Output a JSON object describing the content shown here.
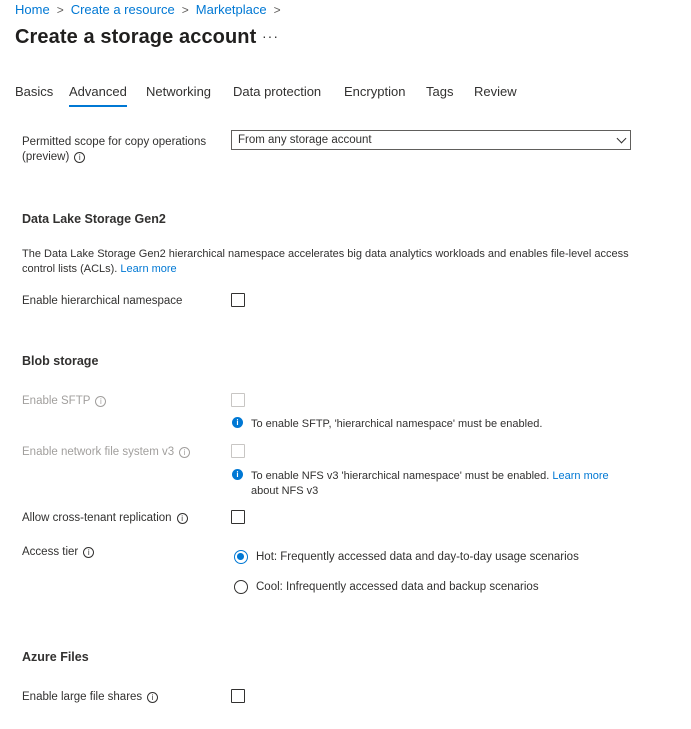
{
  "breadcrumb": {
    "items": [
      "Home",
      "Create a resource",
      "Marketplace"
    ],
    "separator": ">"
  },
  "page": {
    "title": "Create a storage account",
    "more": "···"
  },
  "tabs": [
    {
      "label": "Basics",
      "active": false
    },
    {
      "label": "Advanced",
      "active": true
    },
    {
      "label": "Networking",
      "active": false
    },
    {
      "label": "Data protection",
      "active": false
    },
    {
      "label": "Encryption",
      "active": false
    },
    {
      "label": "Tags",
      "active": false
    },
    {
      "label": "Review",
      "active": false
    }
  ],
  "copy_scope": {
    "label_line1": "Permitted scope for copy operations",
    "label_line2": "(preview)",
    "value": "From any storage account"
  },
  "data_lake": {
    "title": "Data Lake Storage Gen2",
    "desc_line1": "The Data Lake Storage Gen2 hierarchical namespace accelerates big data analytics workloads and enables file-level access",
    "desc_line2": "control lists (ACLs).",
    "learn_more": "Learn more",
    "hns_label": "Enable hierarchical namespace",
    "hns_checked": false
  },
  "blob": {
    "title": "Blob storage",
    "sftp_label": "Enable SFTP",
    "sftp_note": "To enable SFTP, 'hierarchical namespace' must be enabled.",
    "nfs_label": "Enable network file system v3",
    "nfs_note": "To enable NFS v3 'hierarchical namespace' must be enabled.",
    "nfs_learn_more_1": "Learn more",
    "nfs_learn_more_2": "about NFS v3",
    "cross_tenant_label": "Allow cross-tenant replication",
    "cross_tenant_checked": false,
    "access_tier_label": "Access tier",
    "tiers": [
      {
        "label": "Hot: Frequently accessed data and day-to-day usage scenarios",
        "selected": true
      },
      {
        "label": "Cool: Infrequently accessed data and backup scenarios",
        "selected": false
      }
    ]
  },
  "azure_files": {
    "title": "Azure Files",
    "large_shares_label": "Enable large file shares",
    "large_shares_checked": false
  },
  "colors": {
    "accent": "#0078d4",
    "text": "#323130",
    "disabled": "#a19f9d"
  }
}
